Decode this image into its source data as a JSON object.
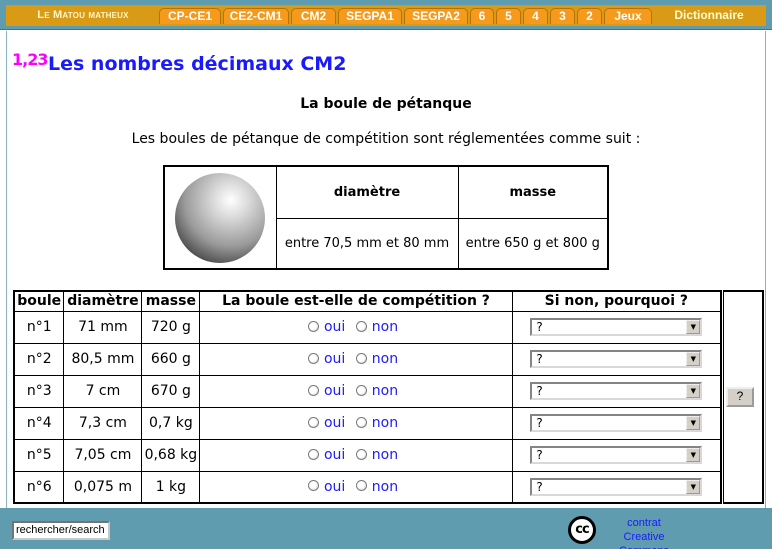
{
  "nav": {
    "brand": "Le Matou matheux",
    "tabs": [
      "CP-CE1",
      "CE2-CM1",
      "CM2",
      "SEGPA1",
      "SEGPA2",
      "6",
      "5",
      "4",
      "3",
      "2",
      "Jeux"
    ],
    "dictionary": "Dictionnaire"
  },
  "page": {
    "badge": "1,23",
    "title": "Les nombres décimaux CM2",
    "subtitle": "La boule de pétanque",
    "intro": "Les boules de pétanque de compétition sont réglementées comme suit :"
  },
  "spec": {
    "diameter_header": "diamètre",
    "mass_header": "masse",
    "diameter_value": "entre 70,5 mm et 80 mm",
    "mass_value": "entre 650 g et 800 g"
  },
  "quiz": {
    "headers": [
      "boule",
      "diamètre",
      "masse",
      "La boule est-elle de compétition ?",
      "Si non, pourquoi ?"
    ],
    "option_yes": "oui",
    "option_no": "non",
    "rows": [
      {
        "ball": "n°1",
        "diameter": "71 mm",
        "mass": "720 g",
        "reason": "?"
      },
      {
        "ball": "n°2",
        "diameter": "80,5 mm",
        "mass": "660 g",
        "reason": "?"
      },
      {
        "ball": "n°3",
        "diameter": "7 cm",
        "mass": "670 g",
        "reason": "?"
      },
      {
        "ball": "n°4",
        "diameter": "7,3 cm",
        "mass": "0,7 kg",
        "reason": "?"
      },
      {
        "ball": "n°5",
        "diameter": "7,05 cm",
        "mass": "0,68 kg",
        "reason": "?"
      },
      {
        "ball": "n°6",
        "diameter": "0,075 m",
        "mass": "1 kg",
        "reason": "?"
      }
    ],
    "help_button": "?"
  },
  "footer": {
    "search_value": "rechercher/search",
    "cc_badge": "cc",
    "license_line1": "contrat",
    "license_line2": "Creative Commons"
  },
  "colors": {
    "nav_bg": "#5f9cb0",
    "tab": "#f59a1a",
    "title": "#1a1aff",
    "badge": "#ff00ff"
  }
}
